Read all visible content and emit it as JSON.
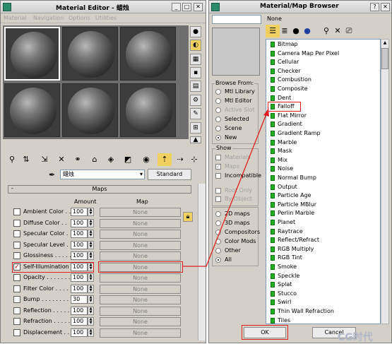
{
  "material_editor": {
    "title": "Material Editor - 蜡烛",
    "menu": [
      "Material",
      "Navigation",
      "Options",
      "Utilities"
    ],
    "current_material": "蜡烛",
    "type_button": "Standard",
    "rollout_title": "Maps",
    "col_amount": "Amount",
    "col_map": "Map",
    "maps": [
      {
        "label": "Ambient Color . .",
        "checked": false,
        "amount": "100",
        "map": "None"
      },
      {
        "label": "Diffuse Color . .",
        "checked": false,
        "amount": "100",
        "map": "None"
      },
      {
        "label": "Specular Color . .",
        "checked": false,
        "amount": "100",
        "map": "None"
      },
      {
        "label": "Specular Level . .",
        "checked": false,
        "amount": "100",
        "map": "None"
      },
      {
        "label": "Glossiness . . . . .",
        "checked": false,
        "amount": "100",
        "map": "None"
      },
      {
        "label": "Self-Illumination .",
        "checked": true,
        "amount": "100",
        "map": "None"
      },
      {
        "label": "Opacity . . . . . . .",
        "checked": false,
        "amount": "100",
        "map": "None"
      },
      {
        "label": "Filter Color . . . .",
        "checked": false,
        "amount": "100",
        "map": "None"
      },
      {
        "label": "Bump . . . . . . . .",
        "checked": false,
        "amount": "30",
        "map": "None"
      },
      {
        "label": "Reflection . . . . .",
        "checked": false,
        "amount": "100",
        "map": "None"
      },
      {
        "label": "Refraction . . . . .",
        "checked": false,
        "amount": "100",
        "map": "None"
      },
      {
        "label": "Displacement . . .",
        "checked": false,
        "amount": "100",
        "map": "None"
      }
    ]
  },
  "map_browser": {
    "title": "Material/Map Browser",
    "search_value": "",
    "selected_name": "None",
    "browse_from_title": "Browse From:",
    "browse_from": [
      {
        "label": "Mtl Library",
        "selected": false,
        "enabled": true
      },
      {
        "label": "Mtl Editor",
        "selected": false,
        "enabled": true
      },
      {
        "label": "Active Slot",
        "selected": false,
        "enabled": false
      },
      {
        "label": "Selected",
        "selected": false,
        "enabled": true
      },
      {
        "label": "Scene",
        "selected": false,
        "enabled": true
      },
      {
        "label": "New",
        "selected": true,
        "enabled": true
      }
    ],
    "show_title": "Show",
    "show": [
      {
        "label": "Materials",
        "checked": false,
        "enabled": false
      },
      {
        "label": "Maps",
        "checked": true,
        "enabled": false
      },
      {
        "label": "Incompatible",
        "checked": false,
        "enabled": true
      }
    ],
    "filters": [
      {
        "label": "Root Only",
        "enabled": false
      },
      {
        "label": "By Object",
        "enabled": false
      }
    ],
    "categories": [
      {
        "label": "2D maps",
        "selected": false
      },
      {
        "label": "3D maps",
        "selected": false
      },
      {
        "label": "Compositors",
        "selected": false
      },
      {
        "label": "Color Mods",
        "selected": false
      },
      {
        "label": "Other",
        "selected": false
      },
      {
        "label": "All",
        "selected": true
      }
    ],
    "map_list": [
      "Bitmap",
      "Camera Map Per Pixel",
      "Cellular",
      "Checker",
      "Combustion",
      "Composite",
      "Dent",
      "Falloff",
      "Flat Mirror",
      "Gradient",
      "Gradient Ramp",
      "Marble",
      "Mask",
      "Mix",
      "Noise",
      "Normal Bump",
      "Output",
      "Particle Age",
      "Particle MBlur",
      "Perlin Marble",
      "Planet",
      "Raytrace",
      "Reflect/Refract",
      "RGB Multiply",
      "RGB Tint",
      "Smoke",
      "Speckle",
      "Splat",
      "Stucco",
      "Swirl",
      "Thin Wall Refraction",
      "Tiles"
    ],
    "ok_label": "OK",
    "cancel_label": "Cancel"
  },
  "watermark": "CG时代"
}
